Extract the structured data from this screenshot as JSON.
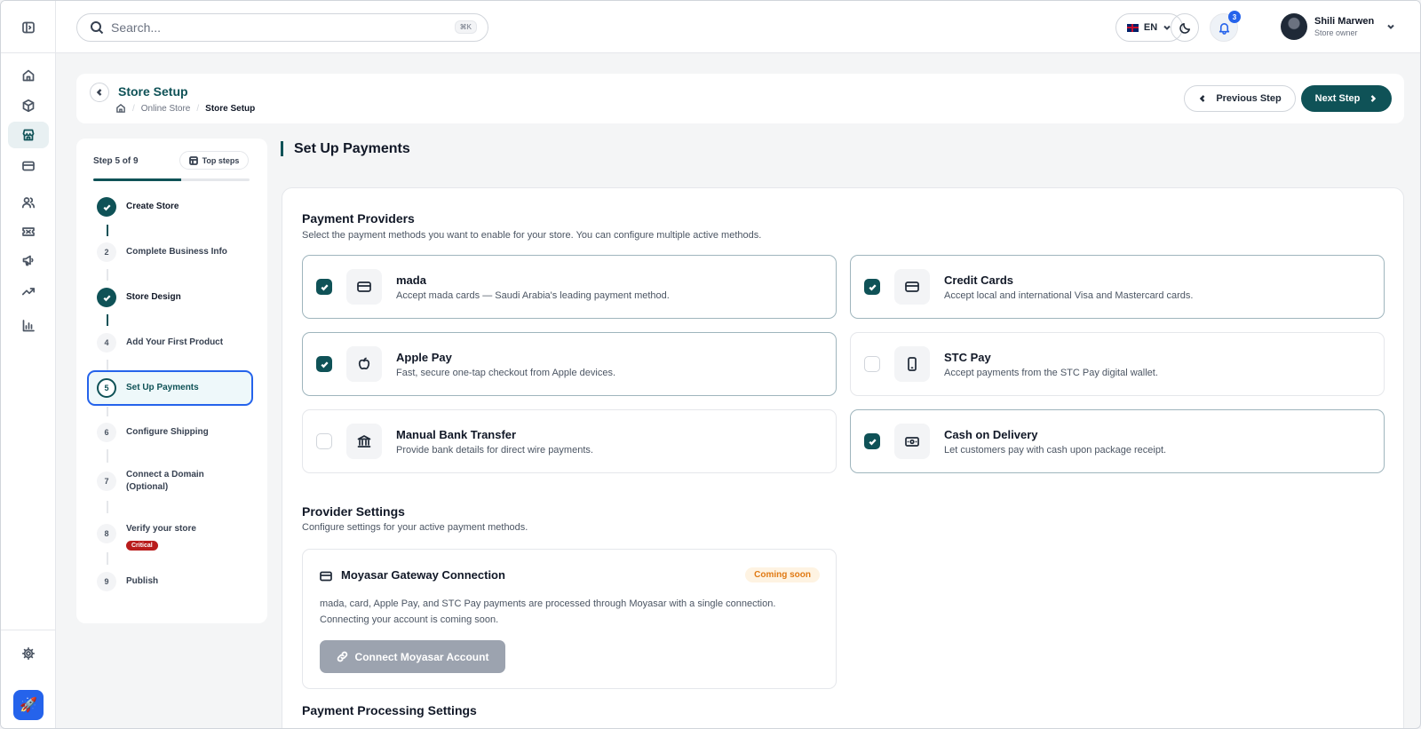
{
  "topbar": {
    "search_placeholder": "Search...",
    "search_shortcut": "⌘K",
    "language": "EN",
    "notifications_count": "3",
    "user_name": "Shili Marwen",
    "user_role": "Store owner"
  },
  "rail": {
    "icons": [
      "sidebar-toggle-icon",
      "home-icon",
      "box-icon",
      "store-icon",
      "card-icon",
      "users-icon",
      "ticket-icon",
      "megaphone-icon",
      "trending-icon",
      "bar-chart-icon",
      "gear-icon",
      "rocket-icon"
    ],
    "active": "store-icon"
  },
  "header": {
    "title": "Store Setup",
    "breadcrumbs": [
      "Online Store",
      "Store Setup"
    ],
    "prev_label": "Previous Step",
    "next_label": "Next Step"
  },
  "steps": {
    "counter": "Step 5 of 9",
    "top_steps_label": "Top steps",
    "progress": 0.56,
    "items": [
      {
        "num": "1",
        "label": "Create Store",
        "status": "done"
      },
      {
        "num": "2",
        "label": "Complete Business Info",
        "status": "todo"
      },
      {
        "num": "3",
        "label": "Store Design",
        "status": "done"
      },
      {
        "num": "4",
        "label": "Add Your First Product",
        "status": "todo"
      },
      {
        "num": "5",
        "label": "Set Up Payments",
        "status": "current"
      },
      {
        "num": "6",
        "label": "Configure Shipping",
        "status": "todo"
      },
      {
        "num": "7",
        "label": "Connect a Domain (Optional)",
        "status": "todo"
      },
      {
        "num": "8",
        "label": "Verify your store",
        "status": "todo",
        "badge": "Critical"
      },
      {
        "num": "9",
        "label": "Publish",
        "status": "todo"
      }
    ]
  },
  "main": {
    "section_title": "Set Up Payments",
    "providers_title": "Payment Providers",
    "providers_subtitle": "Select the payment methods you want to enable for your store. You can configure multiple active methods.",
    "providers": [
      {
        "name": "mada",
        "desc": "Accept mada cards — Saudi Arabia's leading payment method.",
        "checked": true,
        "icon": "card-icon"
      },
      {
        "name": "Credit Cards",
        "desc": "Accept local and international Visa and Mastercard cards.",
        "checked": true,
        "icon": "card-icon"
      },
      {
        "name": "Apple Pay",
        "desc": "Fast, secure one-tap checkout from Apple devices.",
        "checked": true,
        "icon": "apple-icon"
      },
      {
        "name": "STC Pay",
        "desc": "Accept payments from the STC Pay digital wallet.",
        "checked": false,
        "icon": "phone-icon"
      },
      {
        "name": "Manual Bank Transfer",
        "desc": "Provide bank details for direct wire payments.",
        "checked": false,
        "icon": "bank-icon"
      },
      {
        "name": "Cash on Delivery",
        "desc": "Let customers pay with cash upon package receipt.",
        "checked": true,
        "icon": "cash-icon"
      }
    ],
    "settings_title": "Provider Settings",
    "settings_subtitle": "Configure settings for your active payment methods.",
    "gateway": {
      "title": "Moyasar Gateway Connection",
      "badge": "Coming soon",
      "text": "mada, card, Apple Pay, and STC Pay payments are processed through Moyasar with a single connection. Connecting your account is coming soon.",
      "button": "Connect Moyasar Account"
    },
    "processing_title": "Payment Processing Settings"
  },
  "colors": {
    "brand": "#0f5257",
    "accent": "#2563eb",
    "critical": "#b91c1c",
    "warning": "#e07a14"
  }
}
